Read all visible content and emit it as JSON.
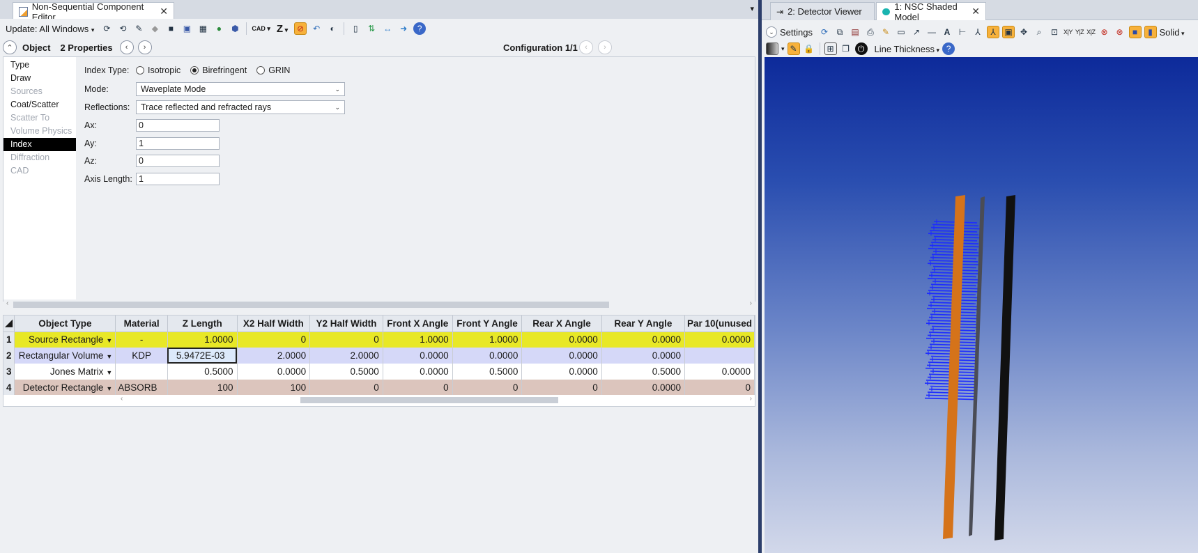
{
  "left_window": {
    "tab_title": "Non-Sequential Component Editor",
    "update_label": "Update: All Windows",
    "cad_label": "CAD",
    "z_label": "Z",
    "object_label": "Object",
    "properties_label": "2 Properties",
    "configuration_label": "Configuration 1/1",
    "side_nav": [
      {
        "label": "Type",
        "state": "normal"
      },
      {
        "label": "Draw",
        "state": "normal"
      },
      {
        "label": "Sources",
        "state": "disabled"
      },
      {
        "label": "Coat/Scatter",
        "state": "normal"
      },
      {
        "label": "Scatter To",
        "state": "disabled"
      },
      {
        "label": "Volume Physics",
        "state": "disabled"
      },
      {
        "label": "Index",
        "state": "selected"
      },
      {
        "label": "Diffraction",
        "state": "disabled"
      },
      {
        "label": "CAD",
        "state": "disabled"
      }
    ],
    "form": {
      "index_type_label": "Index Type:",
      "index_type_options": [
        "Isotropic",
        "Birefringent",
        "GRIN"
      ],
      "index_type_selected": "Birefringent",
      "mode_label": "Mode:",
      "mode_value": "Waveplate Mode",
      "reflections_label": "Reflections:",
      "reflections_value": "Trace reflected and refracted rays",
      "ax_label": "Ax:",
      "ax_value": "0",
      "ay_label": "Ay:",
      "ay_value": "1",
      "az_label": "Az:",
      "az_value": "0",
      "axis_length_label": "Axis Length:",
      "axis_length_value": "1"
    },
    "grid": {
      "columns": [
        "Object Type",
        "Material",
        "Z Length",
        "X2 Half Width",
        "Y2 Half Width",
        "Front X Angle",
        "Front Y Angle",
        "Rear X Angle",
        "Rear Y Angle",
        "Par 10(unused"
      ],
      "rows": [
        {
          "num": "1",
          "type": "Source Rectangle",
          "material": "-",
          "cells": [
            "1.0000",
            "0",
            "0",
            "1.0000",
            "1.0000",
            "0.0000",
            "0.0000",
            "0.0000"
          ]
        },
        {
          "num": "2",
          "type": "Rectangular Volume",
          "material": "KDP",
          "cells": [
            "5.9472E-03",
            "2.0000",
            "2.0000",
            "0.0000",
            "0.0000",
            "0.0000",
            "0.0000",
            ""
          ]
        },
        {
          "num": "3",
          "type": "Jones Matrix",
          "material": "",
          "cells": [
            "0.5000",
            "0.0000",
            "0.5000",
            "0.0000",
            "0.5000",
            "0.0000",
            "0.5000",
            "0.0000"
          ]
        },
        {
          "num": "4",
          "type": "Detector Rectangle",
          "material": "ABSORB",
          "cells": [
            "100",
            "100",
            "0",
            "0",
            "0",
            "0",
            "0.0000",
            "0"
          ]
        }
      ]
    }
  },
  "right_window": {
    "tabs": [
      "2: Detector Viewer",
      "1: NSC Shaded Model"
    ],
    "settings_label": "Settings",
    "axis_labels": [
      "X|Y",
      "Y|Z",
      "X|Z"
    ],
    "solid_label": "Solid",
    "line_thickness_label": "Line Thickness"
  },
  "colors": {
    "row_source": "#e8e826",
    "row_volume": "#d5d8f8",
    "row_detector": "#dcc5bd",
    "accent_toolbar": "#f7b13b",
    "viewer_top": "#0d2a9a",
    "plate_orange": "#d5731a",
    "plate_gray": "#4a4c55",
    "plate_black": "#111111",
    "rays": "#1d2cff"
  }
}
